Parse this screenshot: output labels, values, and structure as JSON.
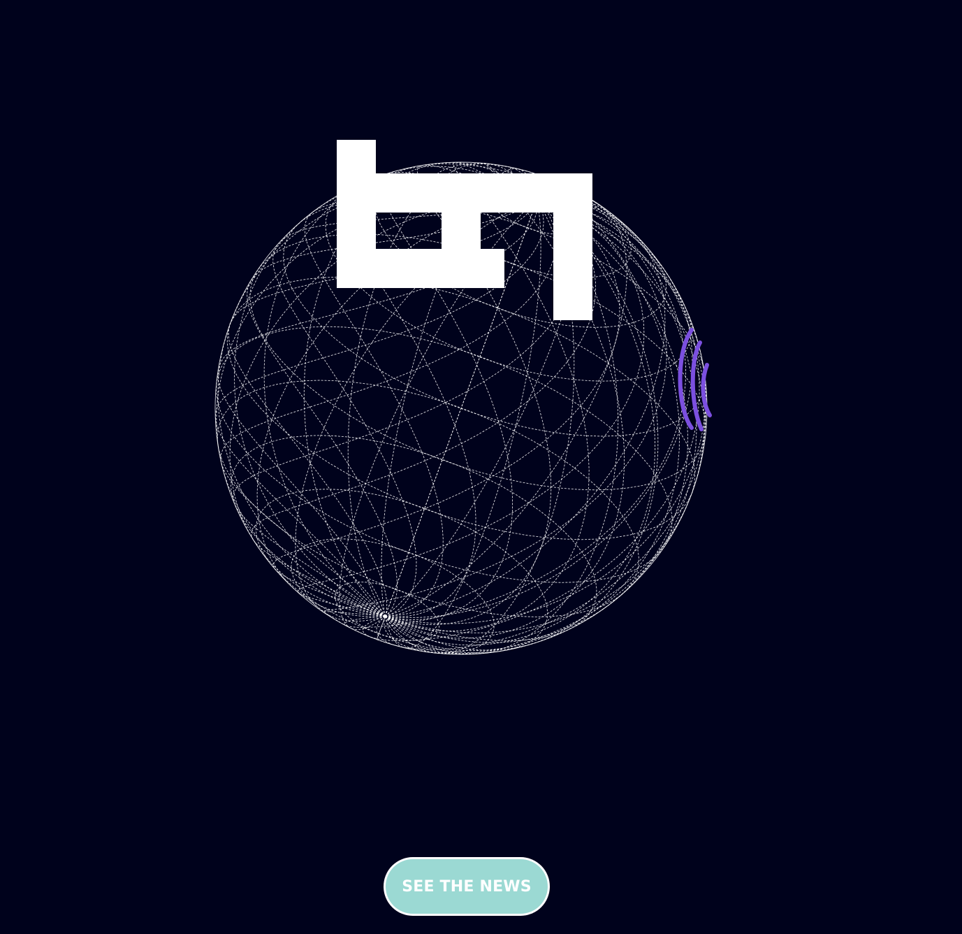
{
  "brand": {
    "logo_text": "tg1",
    "logo_color": "#ffffff"
  },
  "background_color": "#00021c",
  "globe": {
    "style": "wireframe-sphere",
    "line_color": "#ffffff",
    "marker_icon": "purple-wave-marker-icon",
    "marker_color": "#7b4fe0"
  },
  "cta": {
    "label": "SEE THE NEWS",
    "background_color": "#9bd9d3",
    "border_color": "#ffffff"
  }
}
